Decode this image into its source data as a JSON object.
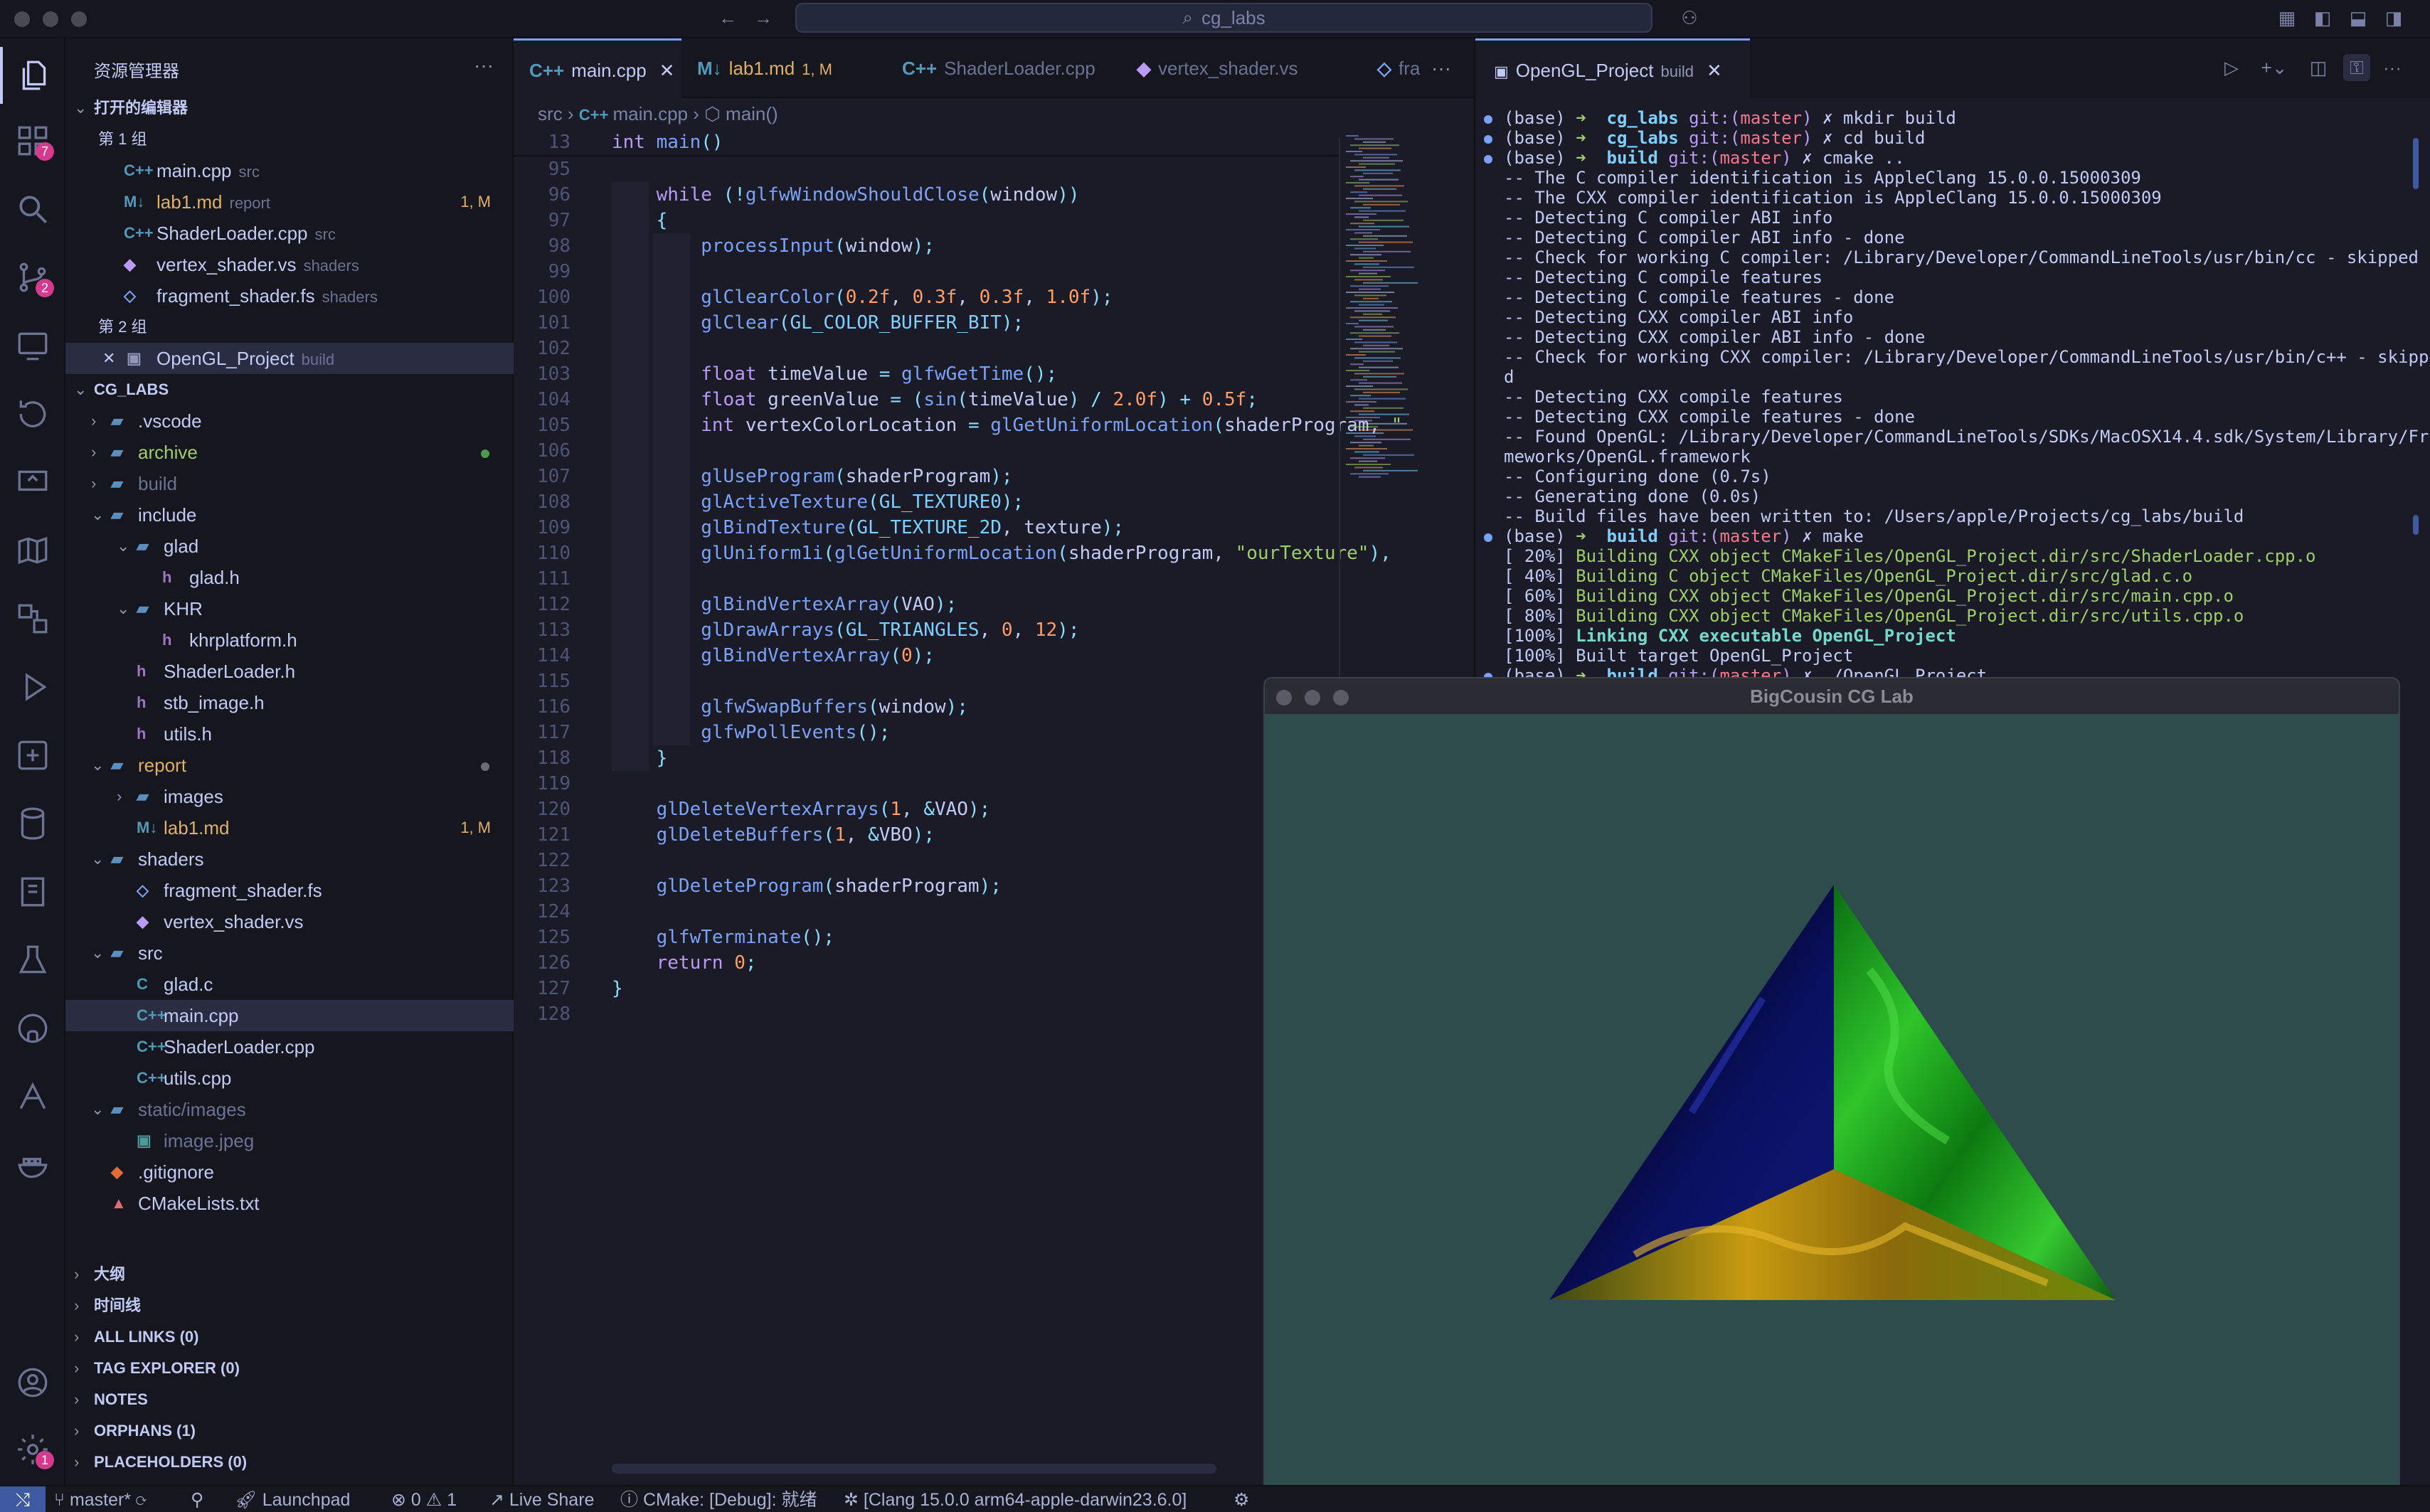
{
  "window": {
    "search_text": "cg_labs"
  },
  "activity_badges": {
    "extensions": "7",
    "scm": "2",
    "accounts": "1"
  },
  "explorer": {
    "title": "资源管理器",
    "open_editors": "打开的编辑器",
    "group1": "第 1 组",
    "group2": "第 2 组",
    "open1": [
      {
        "icon": "C++",
        "name": "main.cpp",
        "sub": "src",
        "right": ""
      },
      {
        "icon": "M↓",
        "name": "lab1.md",
        "sub": "report",
        "right": "1, M"
      },
      {
        "icon": "C++",
        "name": "ShaderLoader.cpp",
        "sub": "src",
        "right": ""
      },
      {
        "icon": "◆",
        "name": "vertex_shader.vs",
        "sub": "shaders",
        "right": ""
      },
      {
        "icon": "◇",
        "name": "fragment_shader.fs",
        "sub": "shaders",
        "right": ""
      }
    ],
    "open2": {
      "name": "OpenGL_Project",
      "sub": "build"
    },
    "root": "CG_LABS",
    "tree": [
      {
        "name": ".vscode",
        "lvl": 1,
        "type": "folder",
        "state": "closed"
      },
      {
        "name": "archive",
        "lvl": 1,
        "type": "folder",
        "state": "closed",
        "dot": "green"
      },
      {
        "name": "build",
        "lvl": 1,
        "type": "folder",
        "state": "closed"
      },
      {
        "name": "include",
        "lvl": 1,
        "type": "folder",
        "state": "open"
      },
      {
        "name": "glad",
        "lvl": 2,
        "type": "folder",
        "state": "open"
      },
      {
        "name": "glad.h",
        "lvl": 3,
        "type": "h"
      },
      {
        "name": "KHR",
        "lvl": 2,
        "type": "folder",
        "state": "open"
      },
      {
        "name": "khrplatform.h",
        "lvl": 3,
        "type": "h"
      },
      {
        "name": "ShaderLoader.h",
        "lvl": 2,
        "type": "h"
      },
      {
        "name": "stb_image.h",
        "lvl": 2,
        "type": "h"
      },
      {
        "name": "utils.h",
        "lvl": 2,
        "type": "h"
      },
      {
        "name": "report",
        "lvl": 1,
        "type": "folder",
        "state": "open",
        "dot": "gray"
      },
      {
        "name": "images",
        "lvl": 2,
        "type": "folder",
        "state": "closed"
      },
      {
        "name": "lab1.md",
        "lvl": 2,
        "type": "md",
        "right": "1, M"
      },
      {
        "name": "shaders",
        "lvl": 1,
        "type": "folder",
        "state": "open"
      },
      {
        "name": "fragment_shader.fs",
        "lvl": 2,
        "type": "fs"
      },
      {
        "name": "vertex_shader.vs",
        "lvl": 2,
        "type": "vs"
      },
      {
        "name": "src",
        "lvl": 1,
        "type": "folder",
        "state": "open"
      },
      {
        "name": "glad.c",
        "lvl": 2,
        "type": "c"
      },
      {
        "name": "main.cpp",
        "lvl": 2,
        "type": "cpp",
        "selected": true
      },
      {
        "name": "ShaderLoader.cpp",
        "lvl": 2,
        "type": "cpp"
      },
      {
        "name": "utils.cpp",
        "lvl": 2,
        "type": "cpp"
      },
      {
        "name": "static/images",
        "lvl": 1,
        "type": "folder",
        "state": "open",
        "dim": true
      },
      {
        "name": "image.jpeg",
        "lvl": 2,
        "type": "img",
        "dim": true
      },
      {
        "name": ".gitignore",
        "lvl": 1,
        "type": "git"
      },
      {
        "name": "CMakeLists.txt",
        "lvl": 1,
        "type": "cmake"
      }
    ],
    "panels": [
      "大纲",
      "时间线",
      "ALL LINKS (0)",
      "TAG EXPLORER (0)",
      "NOTES",
      "ORPHANS (1)",
      "PLACEHOLDERS (0)"
    ]
  },
  "tabs": [
    {
      "icon": "C++",
      "label": "main.cpp",
      "active": true
    },
    {
      "icon": "M↓",
      "label": "lab1.md",
      "sub": "1, M"
    },
    {
      "icon": "C++",
      "label": "ShaderLoader.cpp"
    },
    {
      "icon": "◆",
      "label": "vertex_shader.vs"
    },
    {
      "icon": "◇",
      "label": "fra"
    }
  ],
  "breadcrumb": [
    "src",
    "main.cpp",
    "main()"
  ],
  "code": [
    {
      "n": "13",
      "h": "<span class='kw'>int</span> <span class='fn'>main</span><span class='op'>()</span>"
    },
    {
      "n": "95",
      "h": ""
    },
    {
      "n": "96",
      "h": "    <span class='kw'>while</span> <span class='op'>(!</span><span class='fn'>glfwWindowShouldClose</span><span class='op'>(</span>window<span class='op'>))</span>"
    },
    {
      "n": "97",
      "h": "    <span class='op'>{</span>"
    },
    {
      "n": "98",
      "h": "        <span class='fn'>processInput</span><span class='op'>(</span>window<span class='op'>);</span>"
    },
    {
      "n": "99",
      "h": ""
    },
    {
      "n": "100",
      "h": "        <span class='fn'>glClearColor</span><span class='op'>(</span><span class='nu'>0.2f</span>, <span class='nu'>0.3f</span>, <span class='nu'>0.3f</span>, <span class='nu'>1.0f</span><span class='op'>);</span>"
    },
    {
      "n": "101",
      "h": "        <span class='fn'>glClear</span><span class='op'>(</span><span class='cn'>GL_COLOR_BUFFER_BIT</span><span class='op'>);</span>"
    },
    {
      "n": "102",
      "h": ""
    },
    {
      "n": "103",
      "h": "        <span class='ty'>float</span> timeValue <span class='op'>=</span> <span class='fn'>glfwGetTime</span><span class='op'>();</span>"
    },
    {
      "n": "104",
      "h": "        <span class='ty'>float</span> greenValue <span class='op'>=</span> <span class='op'>(</span><span class='fn'>sin</span><span class='op'>(</span>timeValue<span class='op'>)</span> <span class='op'>/</span> <span class='nu'>2.0f</span><span class='op'>)</span> <span class='op'>+</span> <span class='nu'>0.5f</span><span class='op'>;</span>"
    },
    {
      "n": "105",
      "h": "        <span class='ty'>int</span> vertexColorLocation <span class='op'>=</span> <span class='fn'>glGetUniformLocation</span><span class='op'>(</span>shaderProgram, <span class='st'>\"</span>"
    },
    {
      "n": "106",
      "h": ""
    },
    {
      "n": "107",
      "h": "        <span class='fn'>glUseProgram</span><span class='op'>(</span>shaderProgram<span class='op'>);</span>"
    },
    {
      "n": "108",
      "h": "        <span class='fn'>glActiveTexture</span><span class='op'>(</span><span class='cn'>GL_TEXTURE0</span><span class='op'>);</span>"
    },
    {
      "n": "109",
      "h": "        <span class='fn'>glBindTexture</span><span class='op'>(</span><span class='cn'>GL_TEXTURE_2D</span>, texture<span class='op'>);</span>"
    },
    {
      "n": "110",
      "h": "        <span class='fn'>glUniform1i</span><span class='op'>(</span><span class='fn'>glGetUniformLocation</span><span class='op'>(</span>shaderProgram, <span class='st'>\"ourTexture\"</span><span class='op'>),</span>"
    },
    {
      "n": "111",
      "h": ""
    },
    {
      "n": "112",
      "h": "        <span class='fn'>glBindVertexArray</span><span class='op'>(</span>VAO<span class='op'>);</span>"
    },
    {
      "n": "113",
      "h": "        <span class='fn'>glDrawArrays</span><span class='op'>(</span><span class='cn'>GL_TRIANGLES</span>, <span class='nu'>0</span>, <span class='nu'>12</span><span class='op'>);</span>"
    },
    {
      "n": "114",
      "h": "        <span class='fn'>glBindVertexArray</span><span class='op'>(</span><span class='nu'>0</span><span class='op'>);</span>"
    },
    {
      "n": "115",
      "h": ""
    },
    {
      "n": "116",
      "h": "        <span class='fn'>glfwSwapBuffers</span><span class='op'>(</span>window<span class='op'>);</span>"
    },
    {
      "n": "117",
      "h": "        <span class='fn'>glfwPollEvents</span><span class='op'>();</span>"
    },
    {
      "n": "118",
      "h": "    <span class='op'>}</span>"
    },
    {
      "n": "119",
      "h": ""
    },
    {
      "n": "120",
      "h": "    <span class='fn'>glDeleteVertexArrays</span><span class='op'>(</span><span class='nu'>1</span>, <span class='op'>&amp;</span>VAO<span class='op'>);</span>"
    },
    {
      "n": "121",
      "h": "    <span class='fn'>glDeleteBuffers</span><span class='op'>(</span><span class='nu'>1</span>, <span class='op'>&amp;</span>VBO<span class='op'>);</span>"
    },
    {
      "n": "122",
      "h": ""
    },
    {
      "n": "123",
      "h": "    <span class='fn'>glDeleteProgram</span><span class='op'>(</span>shaderProgram<span class='op'>);</span>"
    },
    {
      "n": "124",
      "h": ""
    },
    {
      "n": "125",
      "h": "    <span class='fn'>glfwTerminate</span><span class='op'>();</span>"
    },
    {
      "n": "126",
      "h": "    <span class='kw'>return</span> <span class='nu'>0</span><span class='op'>;</span>"
    },
    {
      "n": "127",
      "h": "<span class='op'>}</span>"
    },
    {
      "n": "128",
      "h": ""
    }
  ],
  "terminal": {
    "tab_label": "OpenGL_Project",
    "tab_sub": "build",
    "lines": [
      {
        "d": true,
        "h": "<span class='tw'>(base)</span> <span class='tg'>➜</span>  <span class='tc'>cg_labs</span> <span class='tp'>git:(</span><span class='tk'>master</span><span class='tp'>)</span> <span class='tw'>✗ mkdir build</span>"
      },
      {
        "d": true,
        "h": "<span class='tw'>(base)</span> <span class='tg'>➜</span>  <span class='tc'>cg_labs</span> <span class='tp'>git:(</span><span class='tk'>master</span><span class='tp'>)</span> <span class='tw'>✗ cd build</span>"
      },
      {
        "d": true,
        "h": "<span class='tw'>(base)</span> <span class='tg'>➜</span>  <span class='tc'>build</span> <span class='tp'>git:(</span><span class='tk'>master</span><span class='tp'>)</span> <span class='tw'>✗ cmake ..</span>"
      },
      {
        "h": "-- The C compiler identification is AppleClang 15.0.0.15000309"
      },
      {
        "h": "-- The CXX compiler identification is AppleClang 15.0.0.15000309"
      },
      {
        "h": "-- Detecting C compiler ABI info"
      },
      {
        "h": "-- Detecting C compiler ABI info - done"
      },
      {
        "h": "-- Check for working C compiler: /Library/Developer/CommandLineTools/usr/bin/cc - skipped"
      },
      {
        "h": "-- Detecting C compile features"
      },
      {
        "h": "-- Detecting C compile features - done"
      },
      {
        "h": "-- Detecting CXX compiler ABI info"
      },
      {
        "h": "-- Detecting CXX compiler ABI info - done"
      },
      {
        "h": "-- Check for working CXX compiler: /Library/Developer/CommandLineTools/usr/bin/c++ - skippe"
      },
      {
        "h": "d"
      },
      {
        "h": "-- Detecting CXX compile features"
      },
      {
        "h": "-- Detecting CXX compile features - done"
      },
      {
        "h": "-- Found OpenGL: /Library/Developer/CommandLineTools/SDKs/MacOSX14.4.sdk/System/Library/Fra"
      },
      {
        "h": "meworks/OpenGL.framework"
      },
      {
        "h": "-- Configuring done (0.7s)"
      },
      {
        "h": "-- Generating done (0.0s)"
      },
      {
        "h": "-- Build files have been written to: /Users/apple/Projects/cg_labs/build"
      },
      {
        "d": true,
        "h": "<span class='tw'>(base)</span> <span class='tg'>➜</span>  <span class='tc'>build</span> <span class='tp'>git:(</span><span class='tk'>master</span><span class='tp'>)</span> <span class='tw'>✗ make</span>"
      },
      {
        "h": "[ 20%] <span class='tg'>Building CXX object CMakeFiles/OpenGL_Project.dir/src/ShaderLoader.cpp.o</span>"
      },
      {
        "h": "[ 40%] <span class='tg'>Building C object CMakeFiles/OpenGL_Project.dir/src/glad.c.o</span>"
      },
      {
        "h": "[ 60%] <span class='tg'>Building CXX object CMakeFiles/OpenGL_Project.dir/src/main.cpp.o</span>"
      },
      {
        "h": "[ 80%] <span class='tg'>Building CXX object CMakeFiles/OpenGL_Project.dir/src/utils.cpp.o</span>"
      },
      {
        "h": "[100%] <span class='tc' style='color:#73daca'>Linking CXX executable OpenGL_Project</span>"
      },
      {
        "h": "[100%] Built target OpenGL_Project"
      },
      {
        "d": true,
        "h": "<span class='tw'>(base)</span> <span class='tg'>➜</span>  <span class='tc'>build</span> <span class='tp'>git:(</span><span class='tk'>master</span><span class='tp'>)</span> <span class='tw'>✗ ./OpenGL_Project</span>"
      }
    ]
  },
  "gl_window": {
    "title": "BigCousin CG Lab"
  },
  "status": {
    "branch": "master*",
    "launchpad": "Launchpad",
    "errors": "0",
    "warnings": "1",
    "liveshare": "Live Share",
    "cmake": "CMake: [Debug]: 就绪",
    "clang": "[Clang 15.0.0 arm64-apple-darwin23.6.0]"
  },
  "colors": {
    "accent": "#7aa2f7",
    "bg": "#1a1b26",
    "panel": "#16161e",
    "gl_clear": "#2f4c4c"
  }
}
